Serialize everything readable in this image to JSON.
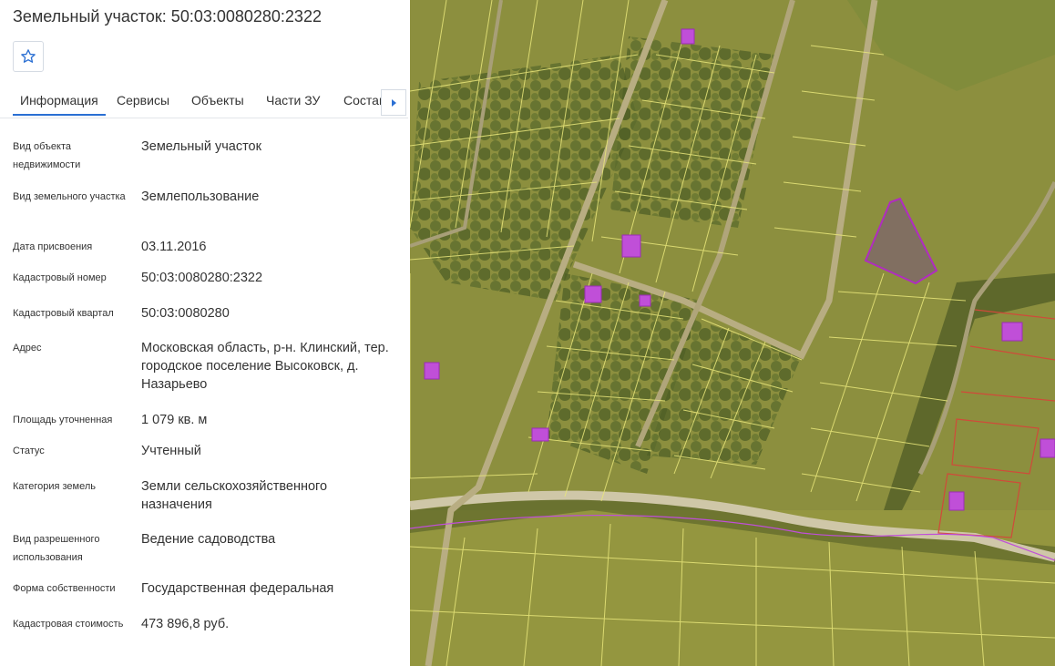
{
  "header": {
    "title": "Земельный участок: 50:03:0080280:2322"
  },
  "favorite": {
    "icon": "star-outline-icon"
  },
  "tabs": [
    {
      "label": "Информация"
    },
    {
      "label": "Сервисы"
    },
    {
      "label": "Объекты"
    },
    {
      "label": "Части ЗУ"
    },
    {
      "label": "Состав"
    }
  ],
  "tabs_scroll_icon": "caret-right-icon",
  "info": [
    {
      "label": "Вид объекта недвижимости",
      "value": "Земельный участок"
    },
    {
      "label": "Вид земельного участка",
      "value": "Землепользование"
    },
    {
      "label": "Дата присвоения",
      "value": "03.11.2016"
    },
    {
      "label": "Кадастровый номер",
      "value": "50:03:0080280:2322"
    },
    {
      "label": "Кадастровый квартал",
      "value": "50:03:0080280"
    },
    {
      "label": "Адрес",
      "value": "Московская область, р-н. Клинский, тер. городское поселение Высоковск, д. Назарьево"
    },
    {
      "label": "Площадь уточненная",
      "value": "1 079 кв. м"
    },
    {
      "label": "Статус",
      "value": "Учтенный"
    },
    {
      "label": "Категория земель",
      "value": "Земли сельскохозяйственного назначения"
    },
    {
      "label": "Вид разрешенного использования",
      "value": "Ведение садоводства"
    },
    {
      "label": "Форма собственности",
      "value": "Государственная федеральная"
    },
    {
      "label": "Кадастровая стоимость",
      "value": "473 896,8 руб."
    }
  ],
  "colors": {
    "accent": "#2a6fd3",
    "parcel_border": "#e8e67a",
    "selected_parcel": "#b02cc0",
    "building": "#c04fd8"
  }
}
